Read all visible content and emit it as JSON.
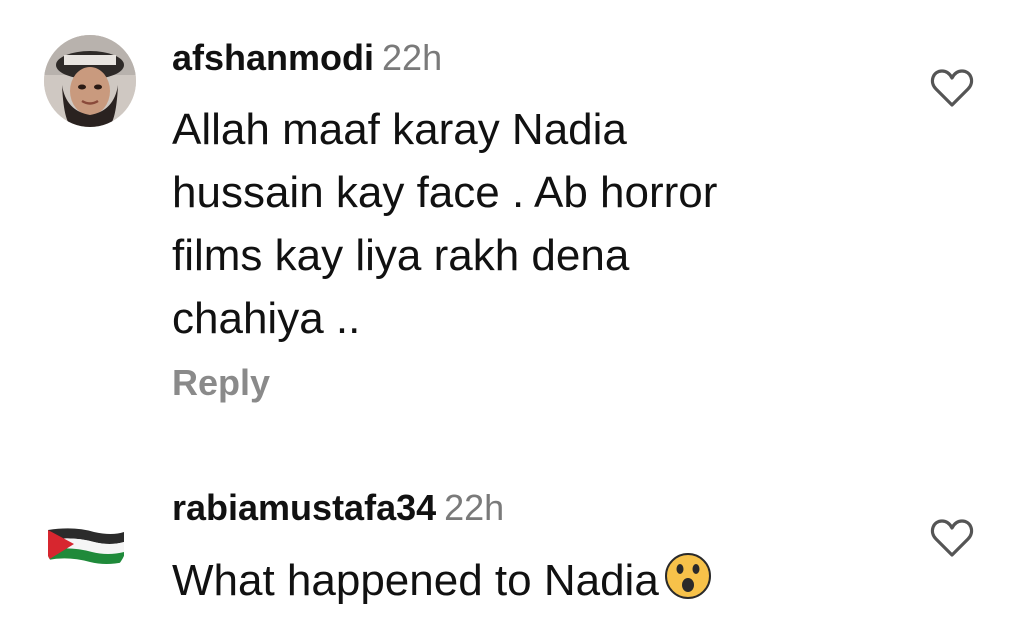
{
  "comments": [
    {
      "username": "afshanmodi",
      "time": "22h",
      "text": "Allah maaf karay Nadia\nhussain kay face . Ab horror\nfilms kay liya rakh dena\nchahiya ..",
      "reply_label": "Reply",
      "avatar": "profile-photo",
      "like_icon": "heart-outline-icon"
    },
    {
      "username": "rabiamustafa34",
      "time": "22h",
      "text": "What happened to Nadia",
      "emoji": "astonished-face-emoji",
      "avatar": "palestine-flag",
      "like_icon": "heart-outline-icon"
    }
  ],
  "colors": {
    "text": "#111111",
    "muted": "#7a7a7a",
    "flag_red": "#d7262f",
    "flag_green": "#1f8a3a"
  }
}
